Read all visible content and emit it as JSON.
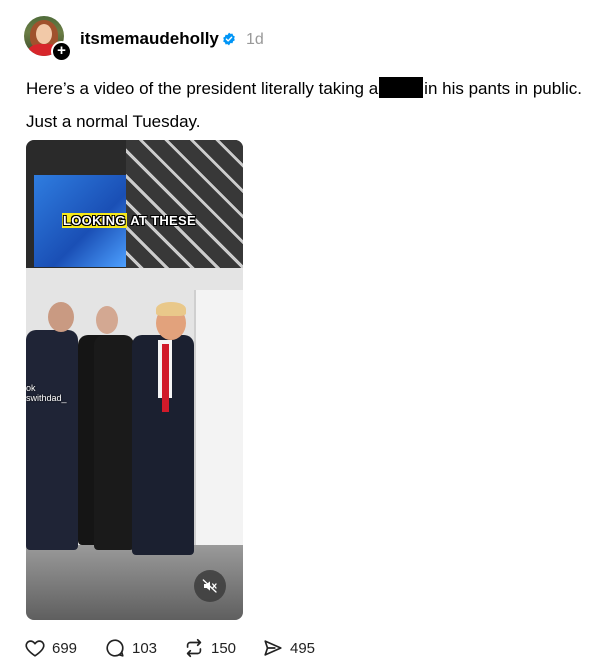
{
  "post": {
    "username": "itsmemaudeholly",
    "timestamp": "1d",
    "text_before_redaction": "Here’s a video of the president literally taking a",
    "text_after_redaction": "in his pants in public.",
    "text_line2": "Just a normal Tuesday."
  },
  "video": {
    "caption_highlight": "LOOKING",
    "caption_rest": "AT THESE",
    "watermark_line1": "ok",
    "watermark_line2": "swithdad_"
  },
  "actions": {
    "likes": "699",
    "replies": "103",
    "reposts": "150",
    "shares": "495"
  },
  "colors": {
    "verified": "#0095f6",
    "timestamp": "#999999",
    "caption_highlight": "#f7e91a"
  }
}
